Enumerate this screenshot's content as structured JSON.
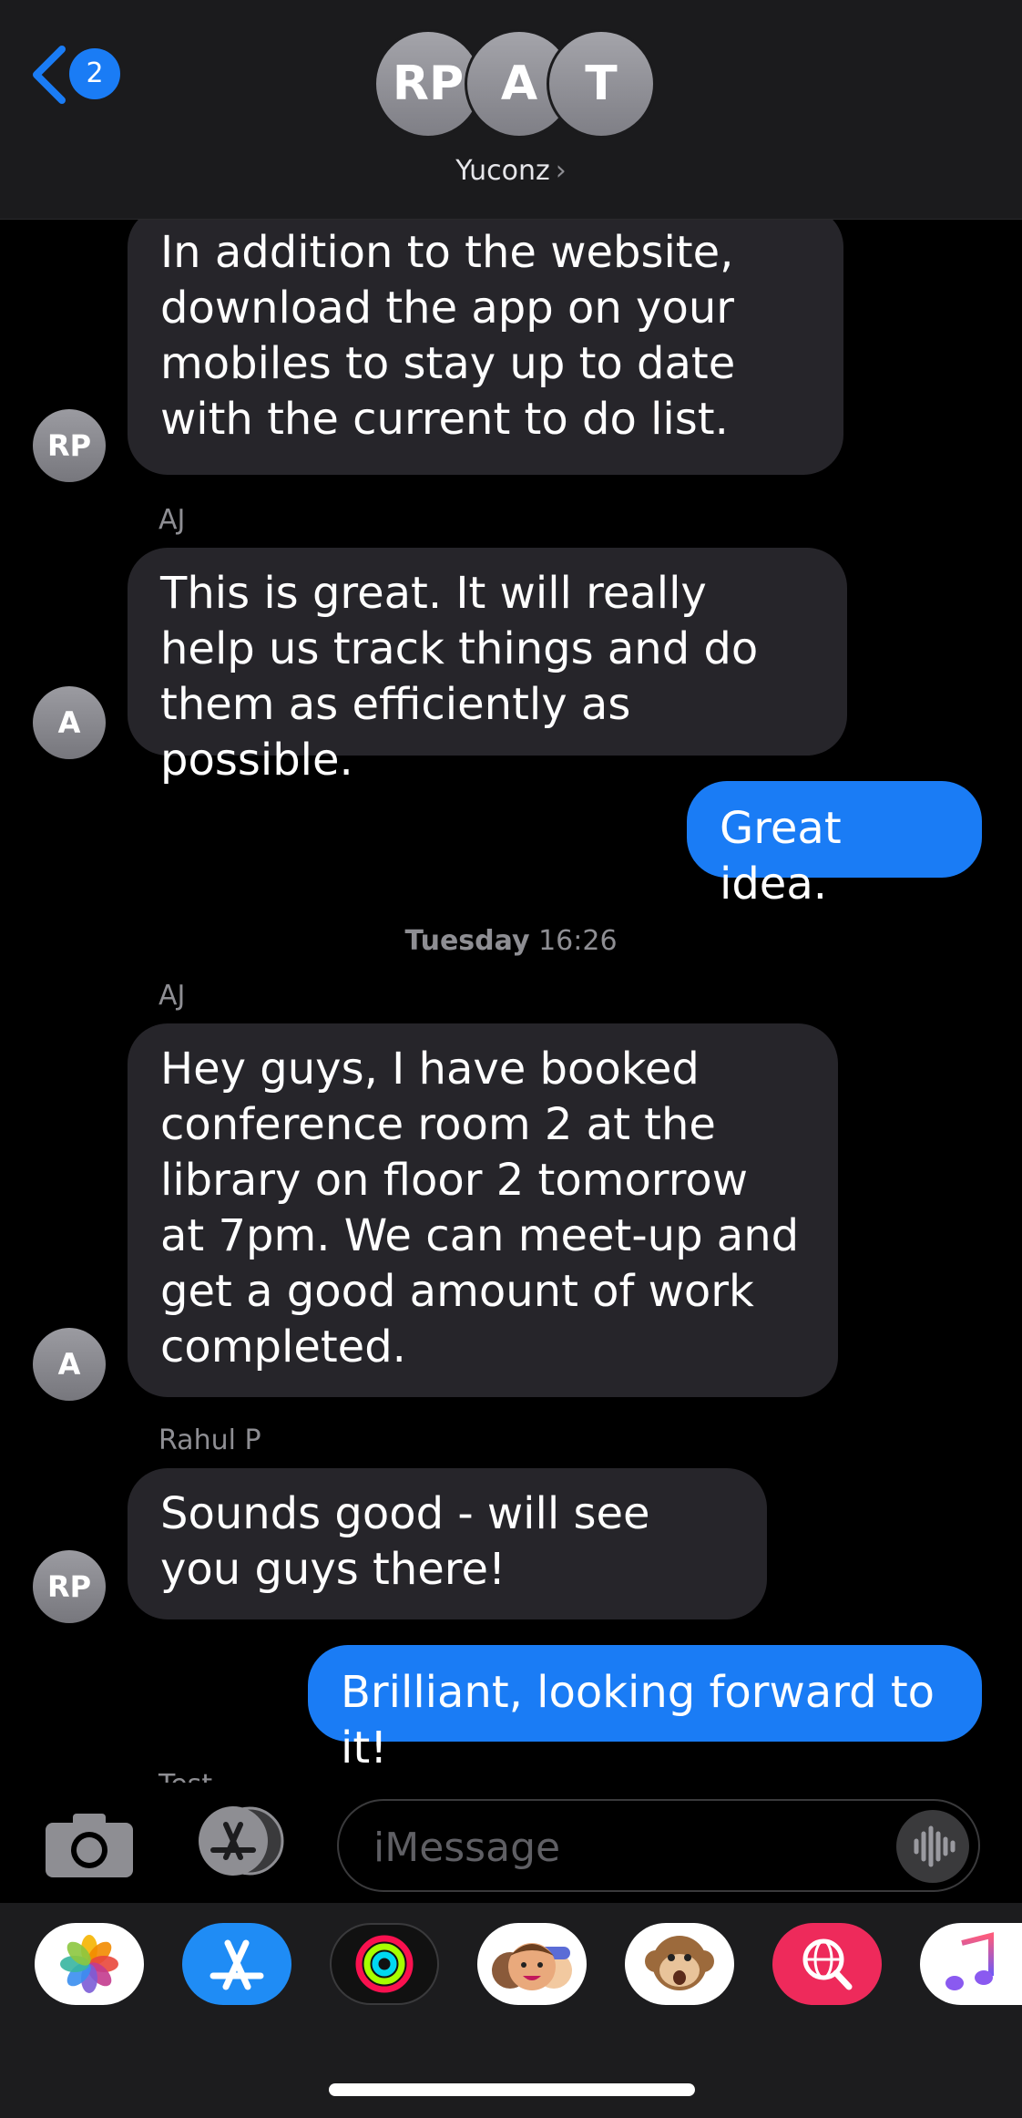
{
  "header": {
    "back_badge": "2",
    "group_name": "Yuconz",
    "avatars": [
      "RP",
      "A",
      "T"
    ]
  },
  "thread": {
    "msg1": {
      "text": "In addition to the website, download the app on your mobiles to stay up to date with the current to do list.",
      "avatar": "RP"
    },
    "msg2": {
      "sender": "AJ",
      "text": "This is great. It will really help us track things and do them as efficiently as possible.",
      "avatar": "A"
    },
    "msg3": {
      "text": "Great idea."
    },
    "timestamp": {
      "day": "Tuesday",
      "time": "16:26"
    },
    "msg4": {
      "sender": "AJ",
      "text": "Hey guys, I have booked conference room 2 at the library on floor 2 tomorrow at 7pm. We can meet-up and get a good amount of work completed.",
      "avatar": "A"
    },
    "msg5": {
      "sender": "Rahul P",
      "text": "Sounds good - will see you guys there!",
      "avatar": "RP"
    },
    "msg6": {
      "text": "Brilliant, looking forward to it!"
    },
    "next_sender": "Test"
  },
  "composer": {
    "placeholder": "iMessage"
  },
  "app_drawer": {
    "apps": [
      "photos-app",
      "app-store-app",
      "activity-app",
      "memoji-app",
      "animoji-app",
      "images-search-app",
      "music-app"
    ]
  },
  "colors": {
    "accent_blue": "#1a7cf5",
    "incoming_bubble": "#26252a",
    "header_bg": "#1b1b1d"
  }
}
